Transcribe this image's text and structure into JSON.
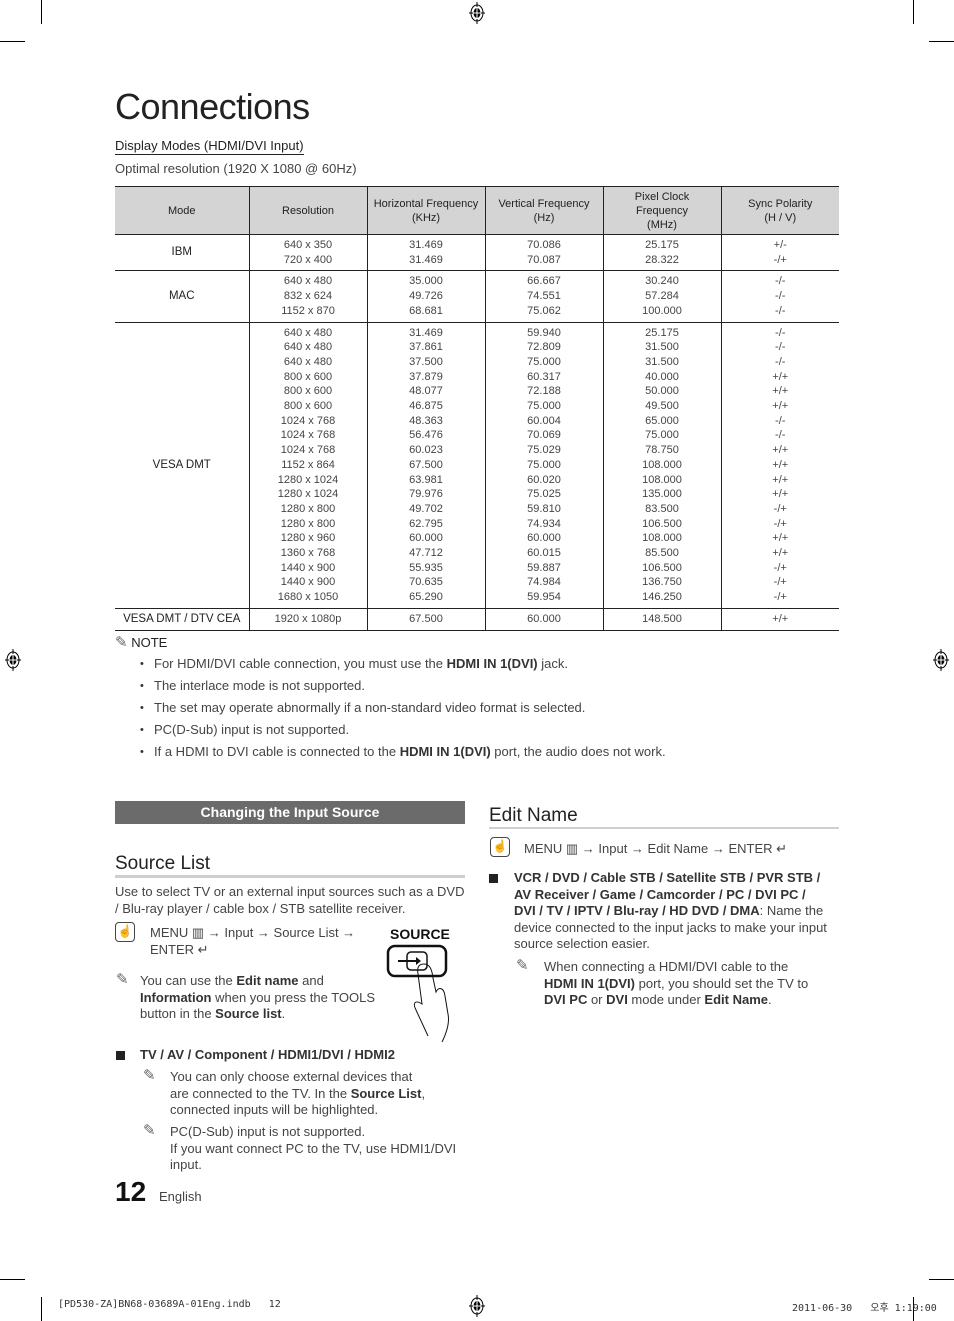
{
  "page": {
    "title": "Connections",
    "page_number": "12",
    "language": "English"
  },
  "display_modes": {
    "heading": "Display Modes (HDMI/DVI Input)",
    "optimal": "Optimal resolution (1920 X 1080 @ 60Hz)",
    "columns": [
      "Mode",
      "Resolution",
      "Horizontal Frequency (KHz)",
      "Vertical Frequency (Hz)",
      "Pixel Clock Frequency (MHz)",
      "Sync Polarity (H / V)"
    ],
    "column_lines": [
      [
        "Mode"
      ],
      [
        "Resolution"
      ],
      [
        "Horizontal Frequency",
        "(KHz)"
      ],
      [
        "Vertical Frequency",
        "(Hz)"
      ],
      [
        "Pixel Clock",
        "Frequency",
        "(MHz)"
      ],
      [
        "Sync Polarity",
        "(H / V)"
      ]
    ],
    "groups": [
      {
        "mode": "IBM",
        "rows": [
          [
            "640 x 350",
            "31.469",
            "70.086",
            "25.175",
            "+/-"
          ],
          [
            "720 x 400",
            "31.469",
            "70.087",
            "28.322",
            "-/+"
          ]
        ]
      },
      {
        "mode": "MAC",
        "rows": [
          [
            "640 x 480",
            "35.000",
            "66.667",
            "30.240",
            "-/-"
          ],
          [
            "832 x 624",
            "49.726",
            "74.551",
            "57.284",
            "-/-"
          ],
          [
            "1152 x 870",
            "68.681",
            "75.062",
            "100.000",
            "-/-"
          ]
        ]
      },
      {
        "mode": "VESA DMT",
        "rows": [
          [
            "640 x 480",
            "31.469",
            "59.940",
            "25.175",
            "-/-"
          ],
          [
            "640 x 480",
            "37.861",
            "72.809",
            "31.500",
            "-/-"
          ],
          [
            "640 x 480",
            "37.500",
            "75.000",
            "31.500",
            "-/-"
          ],
          [
            "800 x 600",
            "37.879",
            "60.317",
            "40.000",
            "+/+"
          ],
          [
            "800 x 600",
            "48.077",
            "72.188",
            "50.000",
            "+/+"
          ],
          [
            "800 x 600",
            "46.875",
            "75.000",
            "49.500",
            "+/+"
          ],
          [
            "1024 x 768",
            "48.363",
            "60.004",
            "65.000",
            "-/-"
          ],
          [
            "1024 x 768",
            "56.476",
            "70.069",
            "75.000",
            "-/-"
          ],
          [
            "1024 x 768",
            "60.023",
            "75.029",
            "78.750",
            "+/+"
          ],
          [
            "1152 x 864",
            "67.500",
            "75.000",
            "108.000",
            "+/+"
          ],
          [
            "1280 x 1024",
            "63.981",
            "60.020",
            "108.000",
            "+/+"
          ],
          [
            "1280 x 1024",
            "79.976",
            "75.025",
            "135.000",
            "+/+"
          ],
          [
            "1280 x 800",
            "49.702",
            "59.810",
            "83.500",
            "-/+"
          ],
          [
            "1280 x 800",
            "62.795",
            "74.934",
            "106.500",
            "-/+"
          ],
          [
            "1280 x 960",
            "60.000",
            "60.000",
            "108.000",
            "+/+"
          ],
          [
            "1360 x 768",
            "47.712",
            "60.015",
            "85.500",
            "+/+"
          ],
          [
            "1440 x 900",
            "55.935",
            "59.887",
            "106.500",
            "-/+"
          ],
          [
            "1440 x 900",
            "70.635",
            "74.984",
            "136.750",
            "-/+"
          ],
          [
            "1680 x 1050",
            "65.290",
            "59.954",
            "146.250",
            "-/+"
          ]
        ]
      },
      {
        "mode": "VESA DMT / DTV CEA",
        "rows": [
          [
            "1920 x 1080p",
            "67.500",
            "60.000",
            "148.500",
            "+/+"
          ]
        ]
      }
    ]
  },
  "note": {
    "label": "NOTE",
    "items": [
      {
        "pre": "For HDMI/DVI cable connection, you must use the ",
        "bold": "HDMI IN 1(DVI)",
        "post": " jack."
      },
      {
        "pre": "The interlace mode is not supported.",
        "bold": "",
        "post": ""
      },
      {
        "pre": "The set may operate abnormally if a non-standard video format is selected.",
        "bold": "",
        "post": ""
      },
      {
        "pre": "PC(D-Sub) input is not supported.",
        "bold": "",
        "post": ""
      },
      {
        "pre": "If a HDMI to DVI cable is connected to the ",
        "bold": "HDMI IN 1(DVI)",
        "post": " port, the audio does not work."
      }
    ]
  },
  "changing_input": {
    "section_bar": "Changing the Input Source",
    "source_list": {
      "title": "Source List",
      "intro_1": "Use to select TV or an external input sources such as a DVD",
      "intro_2": "/ Blu-ray player / cable box / STB satellite receiver.",
      "menu_path_1": "MENU ▥ → Input → Source List →",
      "menu_path_2": "ENTER ↵",
      "remote_button_label": "SOURCE",
      "tip_1_pre": "You can use the ",
      "tip_1_b1": "Edit name",
      "tip_1_mid": " and",
      "tip_2_b": "Information",
      "tip_2_post": " when you press the TOOLS",
      "tip_3_pre": "button in the ",
      "tip_3_b": "Source list",
      "tip_3_post": ".",
      "bullet": "TV / AV / Component / HDMI1/DVI / HDMI2",
      "sub_note_1_l1": "You can only choose external devices that",
      "sub_note_1_l2_pre": "are connected to the TV. In the ",
      "sub_note_1_l2_b": "Source List",
      "sub_note_1_l2_post": ",",
      "sub_note_1_l3": "connected inputs will be highlighted.",
      "sub_note_2_l1": "PC(D-Sub) input is not supported.",
      "sub_note_2_l2": "If you want connect PC to the TV, use HDMI1/DVI",
      "sub_note_2_l3": "input."
    },
    "edit_name": {
      "title": "Edit Name",
      "menu_path": "MENU ▥ → Input → Edit Name → ENTER ↵",
      "bullet_l1": "VCR / DVD / Cable STB / Satellite STB / PVR STB /",
      "bullet_l2": "AV Receiver / Game / Camcorder / PC / DVI PC /",
      "bullet_l3_b": "DVI / TV / IPTV / Blu-ray / HD DVD / DMA",
      "bullet_l3_post": ": Name the",
      "bullet_l4": "device connected to the input jacks to make your input",
      "bullet_l5": "source selection easier.",
      "note_l1": "When connecting a HDMI/DVI cable to the",
      "note_l2_b": "HDMI IN 1(DVI)",
      "note_l2_post": " port, you should set the TV to",
      "note_l3_b1": "DVI PC",
      "note_l3_mid": " or ",
      "note_l3_b2": "DVI",
      "note_l3_mid2": " mode under ",
      "note_l3_b3": "Edit Name",
      "note_l3_post": "."
    }
  },
  "print_footer": {
    "file": "[PD530-ZA]BN68-03689A-01Eng.indb   12",
    "timestamp": "2011-06-30   오후 1:19:00"
  }
}
